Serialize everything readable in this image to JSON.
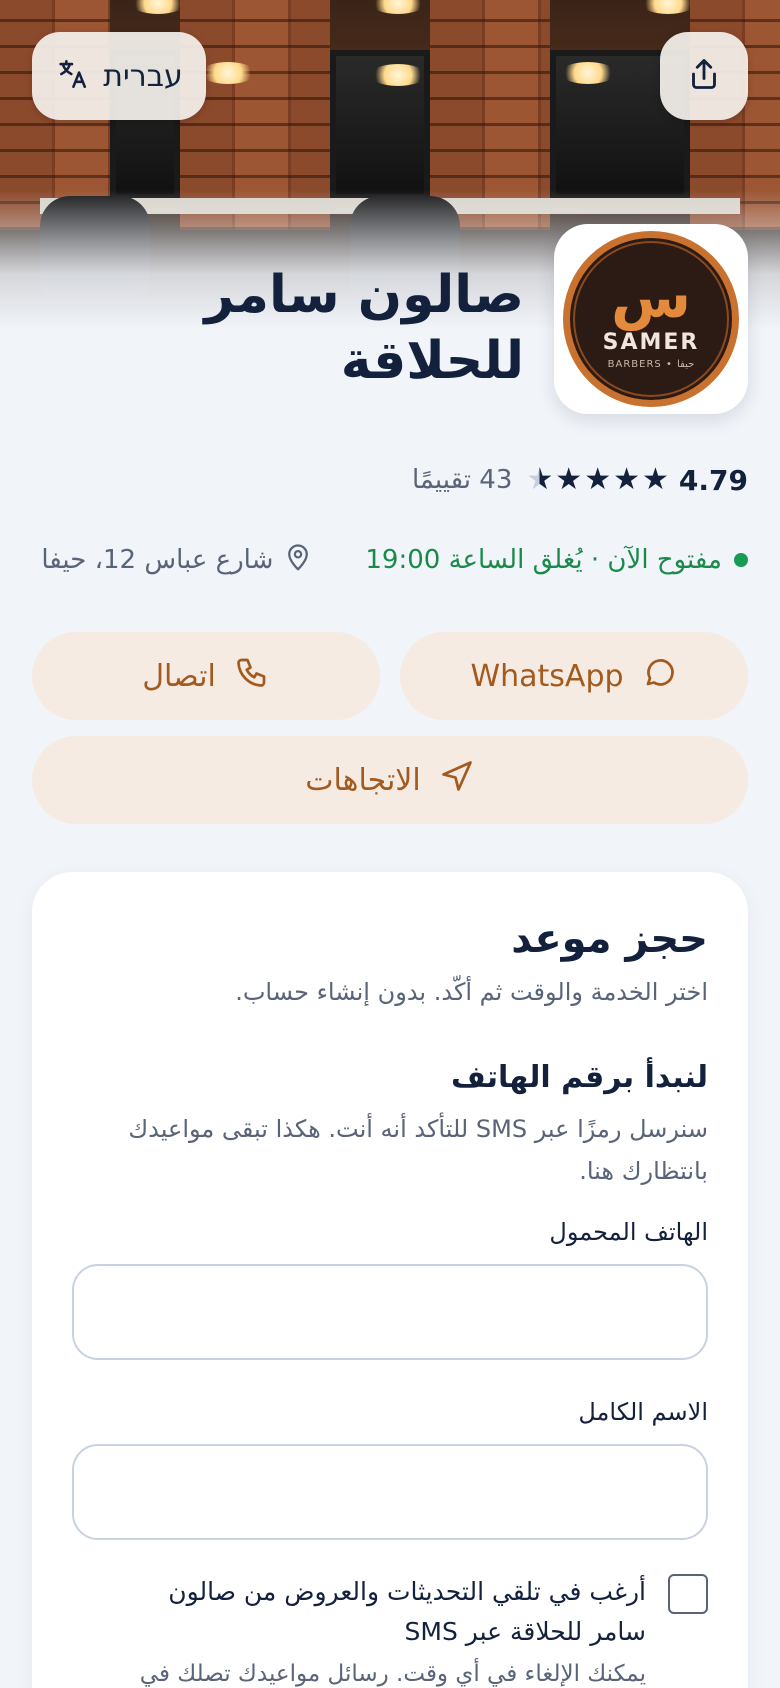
{
  "header": {
    "language_label": "עברית",
    "language_icon": "translate-icon",
    "share_icon": "share-icon"
  },
  "business": {
    "name_line1": "صالون سامر",
    "name_line2": "للحلاقة",
    "logo": {
      "glyph": "س",
      "name": "SAMER",
      "tagline": "BARBERS • حيفا"
    },
    "rating": "4.79",
    "rating_value": 4.79,
    "reviews": "43 تقييمًا",
    "status": "مفتوح الآن · يُغلق الساعة 19:00",
    "address": "شارع عباس 12، حيفا"
  },
  "actions": {
    "whatsapp": "WhatsApp",
    "call": "اتصال",
    "directions": "الاتجاهات"
  },
  "booking": {
    "title": "حجز موعد",
    "subtitle": "اختر الخدمة والوقت ثم أكّد. بدون إنشاء حساب.",
    "step_title": "لنبدأ برقم الهاتف",
    "step_desc": "سنرسل رمزًا عبر SMS للتأكد أنه أنت. هكذا تبقى مواعيدك بانتظارك هنا.",
    "phone_label": "الهاتف المحمول",
    "phone_value": "",
    "name_label": "الاسم الكامل",
    "name_value": "",
    "consent_label": "أرغب في تلقي التحديثات والعروض من صالون سامر للحلاقة عبر SMS",
    "consent_note": "يمكنك الإلغاء في أي وقت. رسائل مواعيدك تصلك في"
  },
  "colors": {
    "brand_accent": "#a35a1f",
    "action_bg": "#f6ebe2",
    "open_green": "#1a8a4a",
    "text_dark": "#14213d"
  }
}
